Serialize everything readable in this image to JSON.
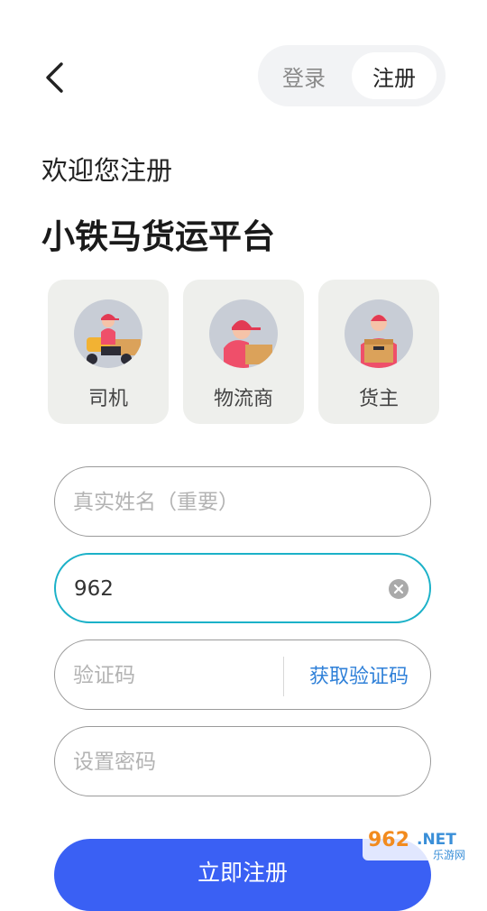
{
  "header": {
    "back_icon": "chevron-left-icon",
    "tabs": [
      {
        "label": "登录",
        "active": false
      },
      {
        "label": "注册",
        "active": true
      }
    ]
  },
  "intro": {
    "welcome": "欢迎您注册",
    "app_name": "小铁马货运平台"
  },
  "roles": [
    {
      "label": "司机",
      "icon": "driver-avatar-icon"
    },
    {
      "label": "物流商",
      "icon": "logistics-avatar-icon"
    },
    {
      "label": "货主",
      "icon": "shipper-avatar-icon"
    }
  ],
  "form": {
    "name_placeholder": "真实姓名（重要）",
    "phone_value": "962",
    "code_placeholder": "验证码",
    "get_code_label": "获取验证码",
    "password_placeholder": "设置密码",
    "submit_label": "立即注册"
  },
  "watermark": {
    "brand": "962.NET",
    "sub": "乐游网"
  },
  "colors": {
    "accent_blue": "#3a60f4",
    "link_blue": "#2f80d8",
    "focus_teal": "#1bb1c8",
    "card_bg": "#eeefec"
  }
}
